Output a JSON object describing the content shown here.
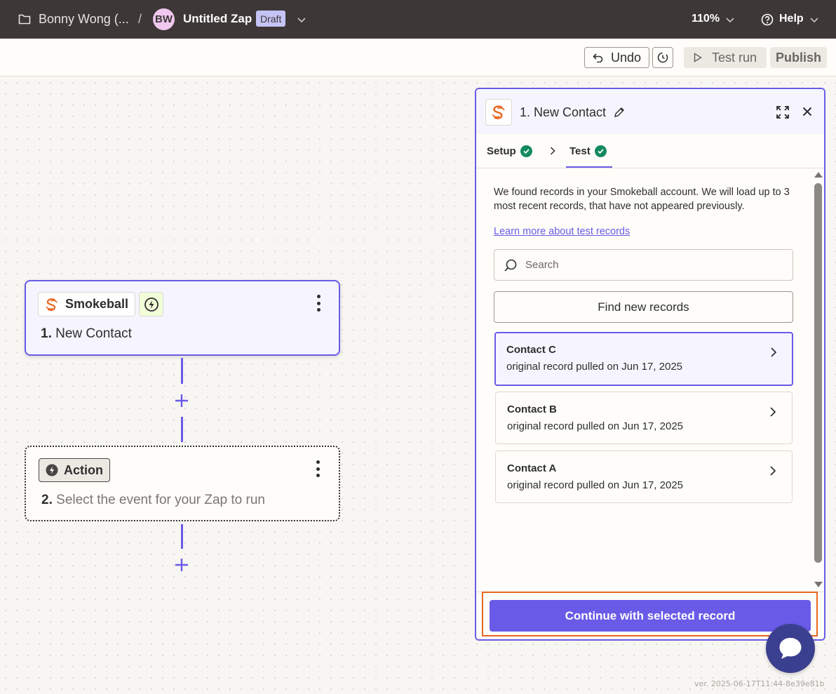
{
  "topbar": {
    "breadcrumb": "Bonny Wong (...",
    "separator": "/",
    "avatar_initials": "BW",
    "zap_name": "Untitled Zap",
    "status_badge": "Draft",
    "zoom": "110%",
    "help": "Help"
  },
  "toolbar": {
    "undo": "Undo",
    "test_run": "Test run",
    "publish": "Publish"
  },
  "canvas": {
    "step1": {
      "app": "Smokeball",
      "number": "1.",
      "title": "New Contact"
    },
    "step2": {
      "chip": "Action",
      "number": "2.",
      "title": "Select the event for your Zap to run"
    }
  },
  "panel": {
    "title": "1. New Contact",
    "tabs": [
      {
        "label": "Setup"
      },
      {
        "label": "Test"
      }
    ],
    "intro": "We found records in your Smokeball account. We will load up to 3 most recent records, that have not appeared previously.",
    "learn_more": "Learn more about test records",
    "search_placeholder": "Search",
    "find_button": "Find new records",
    "records": [
      {
        "name": "Contact C",
        "detail": "original record pulled on Jun 17, 2025",
        "selected": true
      },
      {
        "name": "Contact B",
        "detail": "original record pulled on Jun 17, 2025",
        "selected": false
      },
      {
        "name": "Contact A",
        "detail": "original record pulled on Jun 17, 2025",
        "selected": false
      }
    ],
    "continue_button": "Continue with selected record"
  },
  "version": "ver. 2025-06-17T11:44-8e39e81b",
  "colors": {
    "accent": "#695be8",
    "topbar": "#3d3837",
    "success": "#138a5e",
    "highlight": "#e8671f"
  }
}
